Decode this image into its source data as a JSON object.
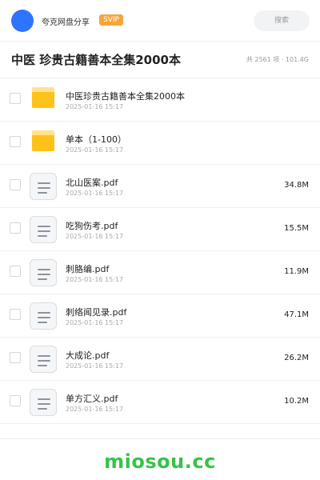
{
  "header": {
    "share_name": "夸克网盘分享",
    "badge": "SVIP",
    "search_placeholder": "搜索"
  },
  "title": {
    "text": "中医 珍贵古籍善本全集2000本",
    "summary": "共 2561 项 · 101.4G"
  },
  "files": [
    {
      "type": "folder",
      "name": "中医珍贵古籍善本全集2000本",
      "date": "2025-01-16 15:17",
      "size": ""
    },
    {
      "type": "folder",
      "name": "单本（1-100）",
      "date": "2025-01-16 15:17",
      "size": ""
    },
    {
      "type": "pdf",
      "name": "北山医案.pdf",
      "date": "2025-01-16 15:17",
      "size": "34.8M"
    },
    {
      "type": "pdf",
      "name": "吃狗伤考.pdf",
      "date": "2025-01-16 15:17",
      "size": "15.5M"
    },
    {
      "type": "pdf",
      "name": "刺胳编.pdf",
      "date": "2025-01-16 15:17",
      "size": "11.9M"
    },
    {
      "type": "pdf",
      "name": "刺络闻见录.pdf",
      "date": "2025-01-16 15:17",
      "size": "47.1M"
    },
    {
      "type": "pdf",
      "name": "大成论.pdf",
      "date": "2025-01-16 15:17",
      "size": "26.2M"
    },
    {
      "type": "pdf",
      "name": "单方汇义.pdf",
      "date": "2025-01-16 15:17",
      "size": "10.2M"
    }
  ],
  "footer": {
    "brand": "miosou.cc"
  },
  "colors": {
    "accent_blue": "#2f74ff",
    "svip_orange": "#f7a43a",
    "folder_yellow": "#ffc21a",
    "brand_green": "#37c24a"
  }
}
